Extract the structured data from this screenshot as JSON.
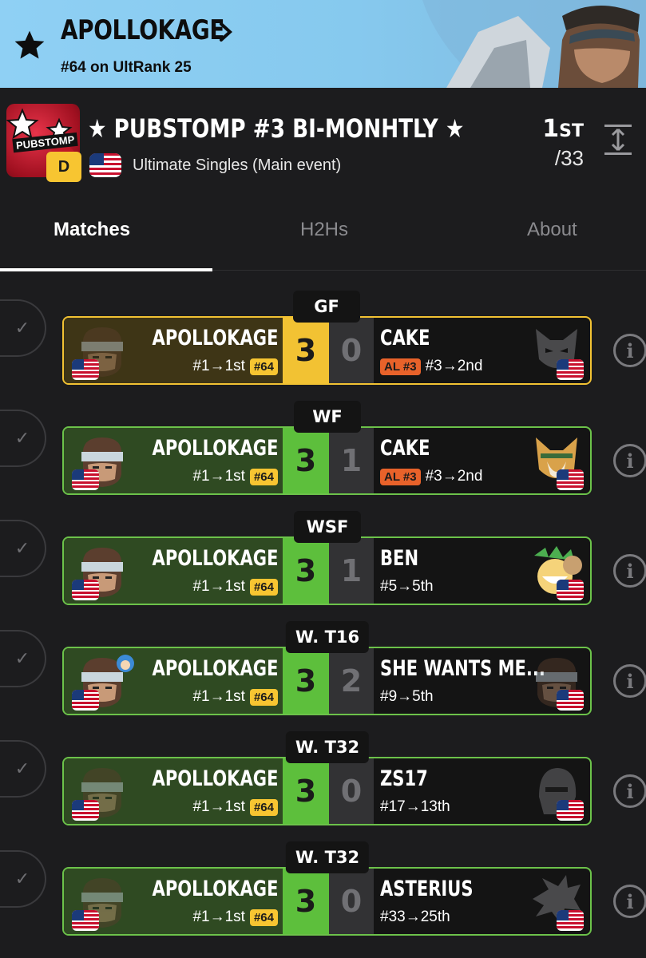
{
  "banner": {
    "player_name": "APOLLOKAGE",
    "rank_text": "#64 on UltRank 25",
    "background_color": "#8fd0f4"
  },
  "event": {
    "title": "★ PUBSTOMP #3 BI-MONHTLY ★",
    "logo_text": "PUBSTOMP",
    "tier": "D",
    "subtitle": "Ultimate Singles (Main event)",
    "placement_number": "1",
    "placement_suffix": "ST",
    "entrants": "/33",
    "flag": "us-flag"
  },
  "tabs": [
    {
      "label": "Matches",
      "active": true
    },
    {
      "label": "H2Hs",
      "active": false
    },
    {
      "label": "About",
      "active": false
    }
  ],
  "matches": [
    {
      "round": "GF",
      "style": "gold",
      "left": {
        "name": "APOLLOKAGE",
        "seed": "#1→1st",
        "badge": "#64",
        "character": "snake"
      },
      "score_left": "3",
      "score_right": "0",
      "right": {
        "name": "CAKE",
        "badge": "AL #3",
        "seed": "#3→2nd",
        "character": "wolf"
      }
    },
    {
      "round": "WF",
      "style": "green",
      "left": {
        "name": "APOLLOKAGE",
        "seed": "#1→1st",
        "badge": "#64",
        "character": "snake"
      },
      "score_left": "3",
      "score_right": "1",
      "right": {
        "name": "CAKE",
        "badge": "AL #3",
        "seed": "#3→2nd",
        "character": "fox"
      }
    },
    {
      "round": "WSF",
      "style": "green",
      "left": {
        "name": "APOLLOKAGE",
        "seed": "#1→1st",
        "badge": "#64",
        "character": "snake"
      },
      "score_left": "3",
      "score_right": "1",
      "right": {
        "name": "BEN",
        "badge": "",
        "seed": "#5→5th",
        "character": "bowser-jr"
      }
    },
    {
      "round": "W. T16",
      "style": "green",
      "left": {
        "name": "APOLLOKAGE",
        "seed": "#1→1st",
        "badge": "#64",
        "character": "snake"
      },
      "score_left": "3",
      "score_right": "2",
      "right": {
        "name": "SHE WANTS ME...",
        "badge": "",
        "seed": "#9→5th",
        "character": "snake"
      }
    },
    {
      "round": "W. T32",
      "style": "green",
      "left": {
        "name": "APOLLOKAGE",
        "seed": "#1→1st",
        "badge": "#64",
        "character": "snake"
      },
      "score_left": "3",
      "score_right": "0",
      "right": {
        "name": "ZS17",
        "badge": "",
        "seed": "#17→13th",
        "character": "bayonetta"
      }
    },
    {
      "round": "W. T32",
      "style": "green",
      "left": {
        "name": "APOLLOKAGE",
        "seed": "#1→1st",
        "badge": "#64",
        "character": "snake"
      },
      "score_left": "3",
      "score_right": "0",
      "right": {
        "name": "ASTERIUS",
        "badge": "",
        "seed": "#33→25th",
        "character": "cloud"
      }
    }
  ],
  "colors": {
    "win_green": "#5dbf3c",
    "win_gold": "#f2c233",
    "rank_badge": "#f7c531",
    "al_badge": "#e8622a"
  }
}
